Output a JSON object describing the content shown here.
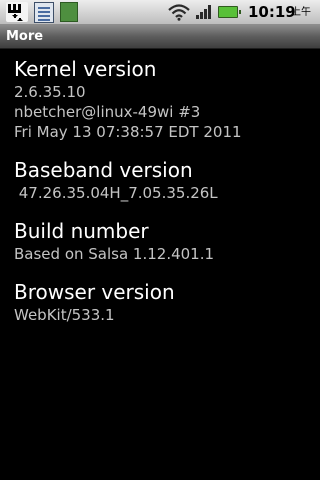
{
  "status_bar": {
    "time": "10:19",
    "ampm": "上午",
    "notification_icons": [
      "usb-debugging-icon",
      "document-icon",
      "app-icon"
    ],
    "system_icons": [
      "wifi-icon",
      "signal-icon",
      "battery-icon"
    ],
    "colors": {
      "battery": "#58c038"
    }
  },
  "title_bar": {
    "title": "More"
  },
  "sections": {
    "kernel": {
      "title": "Kernel version",
      "lines": [
        "2.6.35.10",
        "nbetcher@linux-49wi #3",
        "Fri May 13 07:38:57 EDT 2011"
      ]
    },
    "baseband": {
      "title": "Baseband version",
      "value": " 47.26.35.04H_7.05.35.26L"
    },
    "build": {
      "title": "Build number",
      "value": "Based on Salsa 1.12.401.1"
    },
    "browser": {
      "title": "Browser version",
      "value": "WebKit/533.1"
    }
  }
}
